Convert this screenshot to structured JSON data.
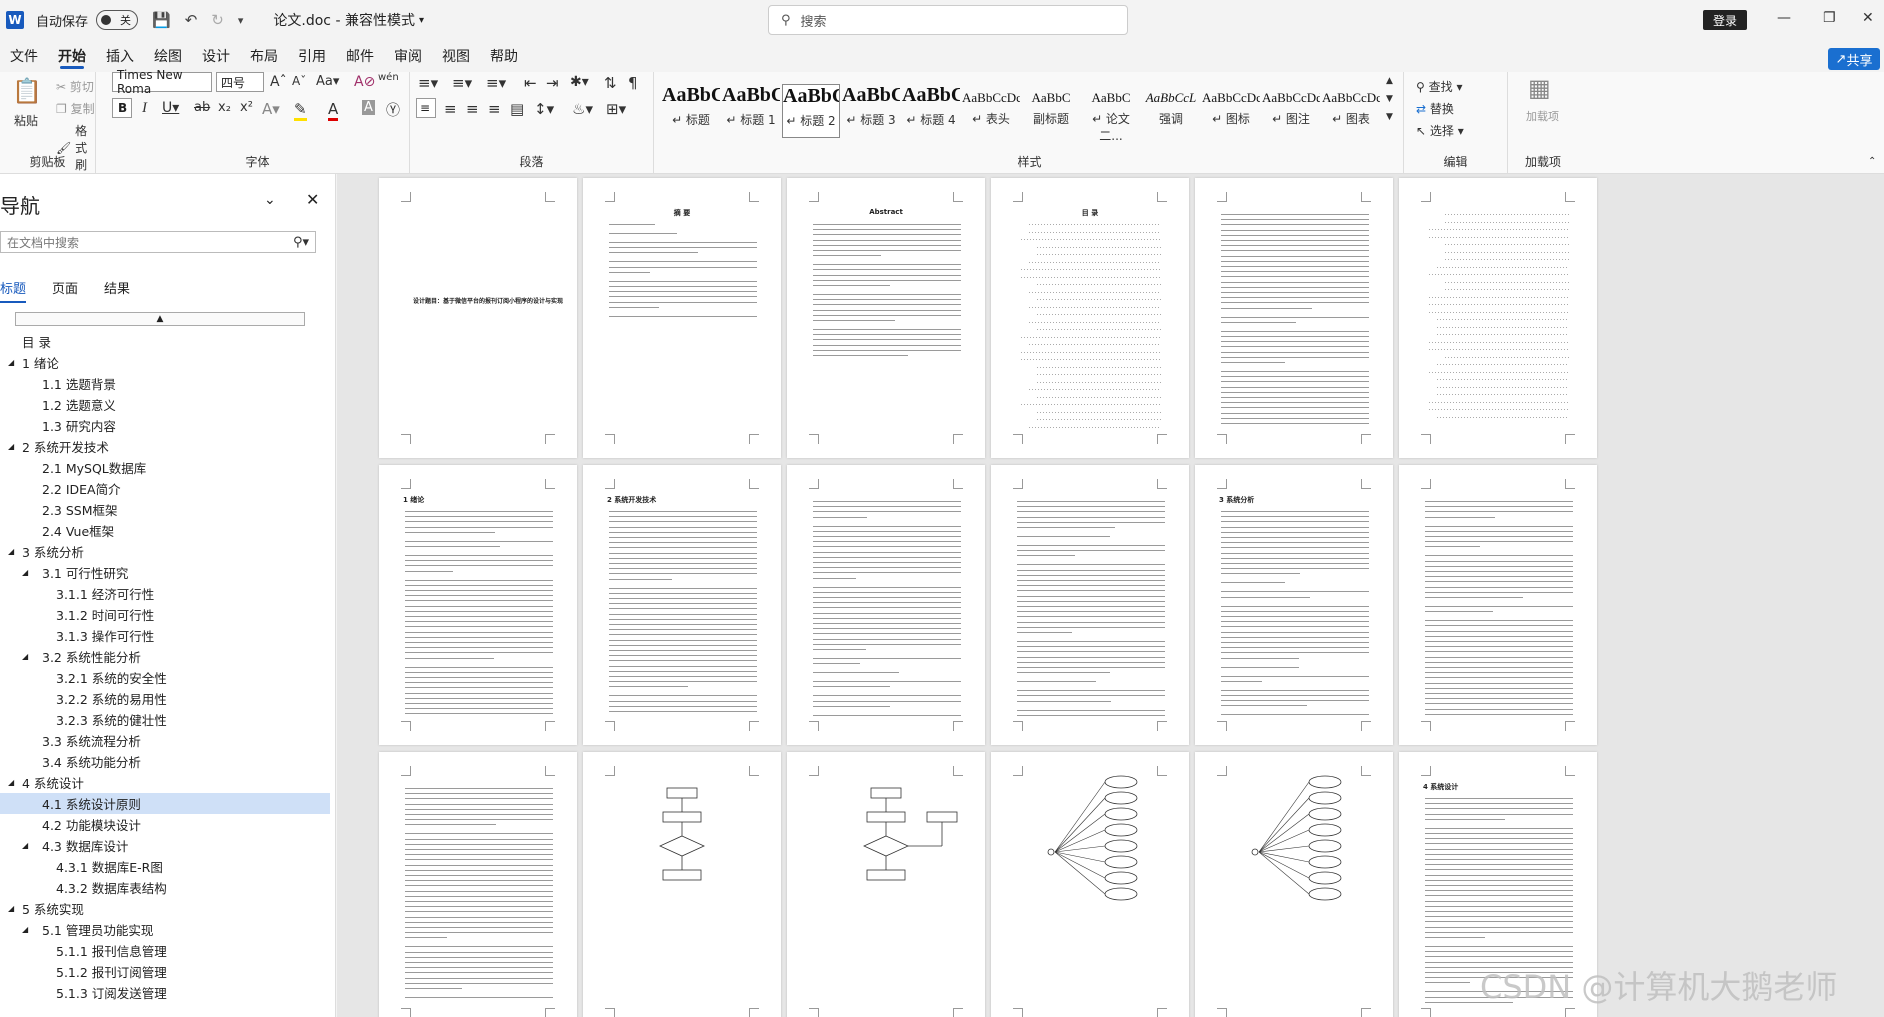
{
  "app": {
    "autosave_label": "自动保存",
    "autosave_state": "关",
    "doc_title": "论文.doc - 兼容性模式",
    "search_placeholder": "搜索",
    "login_label": "登录",
    "share_label": "共享"
  },
  "menu": [
    "文件",
    "开始",
    "插入",
    "绘图",
    "设计",
    "布局",
    "引用",
    "邮件",
    "审阅",
    "视图",
    "帮助"
  ],
  "ribbon": {
    "clipboard": {
      "paste": "粘贴",
      "cut": "剪切",
      "copy": "复制",
      "format_painter": "格式刷",
      "label": "剪贴板"
    },
    "font": {
      "name": "Times New Roma",
      "size": "四号",
      "label": "字体"
    },
    "paragraph": {
      "label": "段落"
    },
    "styles": {
      "label": "样式",
      "items": [
        {
          "preview": "AaBbC",
          "name": "标题"
        },
        {
          "preview": "AaBbC",
          "name": "标题 1"
        },
        {
          "preview": "AaBbC",
          "name": "标题 2"
        },
        {
          "preview": "AaBbCcl",
          "name": "标题 3"
        },
        {
          "preview": "AaBbC",
          "name": "标题 4"
        },
        {
          "preview": "AaBbCcDc",
          "name": "表头"
        },
        {
          "preview": "AaBbC",
          "name": "副标题"
        },
        {
          "preview": "AaBbC",
          "name": "论文二..."
        },
        {
          "preview": "AaBbCcL",
          "name": "强调"
        },
        {
          "preview": "AaBbCcDc",
          "name": "图标"
        },
        {
          "preview": "AaBbCcDd",
          "name": "图注"
        },
        {
          "preview": "AaBbCcDc",
          "name": "图表"
        }
      ]
    },
    "editing": {
      "find": "查找",
      "replace": "替换",
      "select": "选择",
      "label": "编辑"
    },
    "addins": {
      "addin": "加载项",
      "label": "加载项"
    }
  },
  "nav": {
    "title": "导航",
    "search_placeholder": "在文档中搜索",
    "tabs": [
      "标题",
      "页面",
      "结果"
    ],
    "toc": [
      {
        "level": 0,
        "text": "目 录"
      },
      {
        "level": 0,
        "text": "1 绪论",
        "exp": true
      },
      {
        "level": 1,
        "text": "1.1 选题背景"
      },
      {
        "level": 1,
        "text": "1.2 选题意义"
      },
      {
        "level": 1,
        "text": "1.3 研究内容"
      },
      {
        "level": 0,
        "text": "2 系统开发技术",
        "exp": true
      },
      {
        "level": 1,
        "text": "2.1 MySQL数据库"
      },
      {
        "level": 1,
        "text": "2.2 IDEA简介"
      },
      {
        "level": 1,
        "text": "2.3 SSM框架"
      },
      {
        "level": 1,
        "text": "2.4 Vue框架"
      },
      {
        "level": 0,
        "text": "3 系统分析",
        "exp": true
      },
      {
        "level": 1,
        "text": "3.1 可行性研究",
        "exp": true
      },
      {
        "level": 2,
        "text": "3.1.1 经济可行性"
      },
      {
        "level": 2,
        "text": "3.1.2 时间可行性"
      },
      {
        "level": 2,
        "text": "3.1.3 操作可行性"
      },
      {
        "level": 1,
        "text": "3.2 系统性能分析",
        "exp": true
      },
      {
        "level": 2,
        "text": "3.2.1 系统的安全性"
      },
      {
        "level": 2,
        "text": "3.2.2 系统的易用性"
      },
      {
        "level": 2,
        "text": "3.2.3 系统的健壮性"
      },
      {
        "level": 1,
        "text": "3.3 系统流程分析"
      },
      {
        "level": 1,
        "text": "3.4 系统功能分析"
      },
      {
        "level": 0,
        "text": "4 系统设计",
        "exp": true
      },
      {
        "level": 1,
        "text": "4.1 系统设计原则",
        "sel": true
      },
      {
        "level": 1,
        "text": "4.2 功能模块设计"
      },
      {
        "level": 1,
        "text": "4.3 数据库设计",
        "exp": true
      },
      {
        "level": 2,
        "text": "4.3.1 数据库E-R图"
      },
      {
        "level": 2,
        "text": "4.3.2 数据库表结构"
      },
      {
        "level": 0,
        "text": "5 系统实现",
        "exp": true
      },
      {
        "level": 1,
        "text": "5.1 管理员功能实现",
        "exp": true
      },
      {
        "level": 2,
        "text": "5.1.1 报刊信息管理"
      },
      {
        "level": 2,
        "text": "5.1.2 报刊订阅管理"
      },
      {
        "level": 2,
        "text": "5.1.3 订阅发送管理"
      }
    ]
  },
  "pages": {
    "p1_title": "设计题目：基于微信平台的报刊订阅小程序的设计与实现",
    "p2_title": "摘  要",
    "p3_title": "Abstract",
    "p4_title": "目  录",
    "p7_title": "1  绪论",
    "p8_title": "2  系统开发技术",
    "p11_title": "3  系统分析",
    "p18_title": "4  系统设计"
  },
  "watermark": "CSDN @计算机大鹅老师"
}
